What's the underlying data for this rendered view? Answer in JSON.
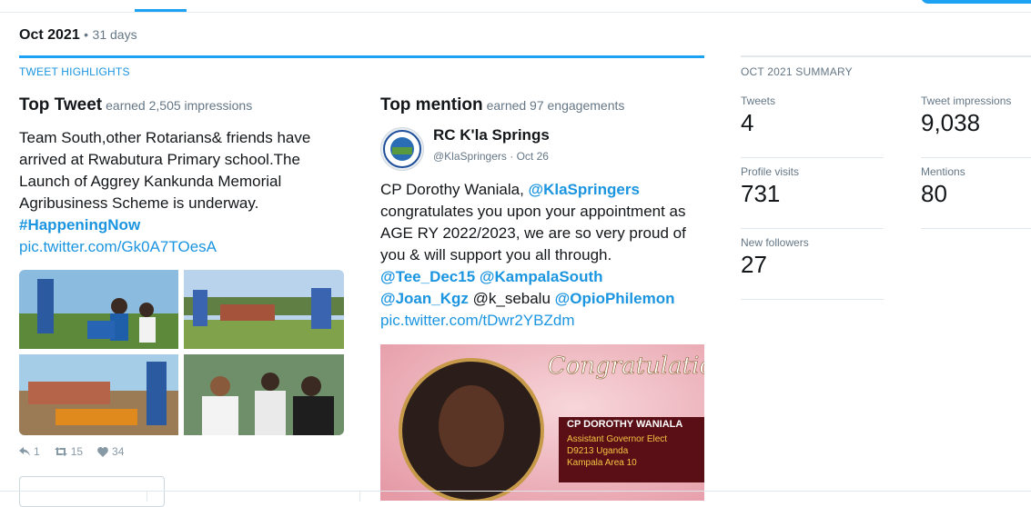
{
  "period": {
    "month": "Oct 2021",
    "separator": "•",
    "days": "31 days"
  },
  "highlights": {
    "section_label": "TWEET HIGHLIGHTS",
    "top_tweet": {
      "title": "Top Tweet",
      "subtitle": "earned 2,505 impressions",
      "text_lines": [
        "Team South,other Rotarians& friends have",
        "arrived at Rwabutura Primary school.The",
        "Launch of Aggrey Kankunda Memorial",
        "Agribusiness Scheme is underway."
      ],
      "hashtag": "#HappeningNow",
      "link": "pic.twitter.com/Gk0A7TOesA",
      "replies": "1",
      "retweets": "15",
      "likes": "34"
    },
    "top_mention": {
      "title": "Top mention",
      "subtitle": "earned 97 engagements",
      "author_name": "RC K'la Springs",
      "author_handle": "@KlaSpringers",
      "dot": "·",
      "date": "Oct 26",
      "text_1": "CP Dorothy Waniala, ",
      "mention_1": "@KlaSpringers",
      "text_2": "congratulates you upon your appointment as AGE RY 2022/2023, we are so very proud of you & will support you all through.",
      "mention_2": "@Tee_Dec15",
      "mention_3": "@KampalaSouth",
      "mention_4": "@Joan_Kgz",
      "plain_handle": "@k_sebalu",
      "mention_5": "@OpioPhilemon",
      "link": "pic.twitter.com/tDwr2YBZdm",
      "image_text": {
        "headline": "Congratulations",
        "name": "CP DOROTHY WANIALA",
        "line1": "Assistant Governor Elect",
        "line2": "D9213 Uganda",
        "line3": "Kampala Area 10"
      }
    }
  },
  "summary": {
    "section_label": "OCT 2021 SUMMARY",
    "metrics": [
      {
        "label": "Tweets",
        "value": "4"
      },
      {
        "label": "Tweet impressions",
        "value": "9,038"
      },
      {
        "label": "Profile visits",
        "value": "731"
      },
      {
        "label": "Mentions",
        "value": "80"
      },
      {
        "label": "New followers",
        "value": "27"
      }
    ]
  },
  "colors": {
    "accent": "#1da1f2",
    "link": "#1b95e0",
    "muted": "#657786"
  }
}
